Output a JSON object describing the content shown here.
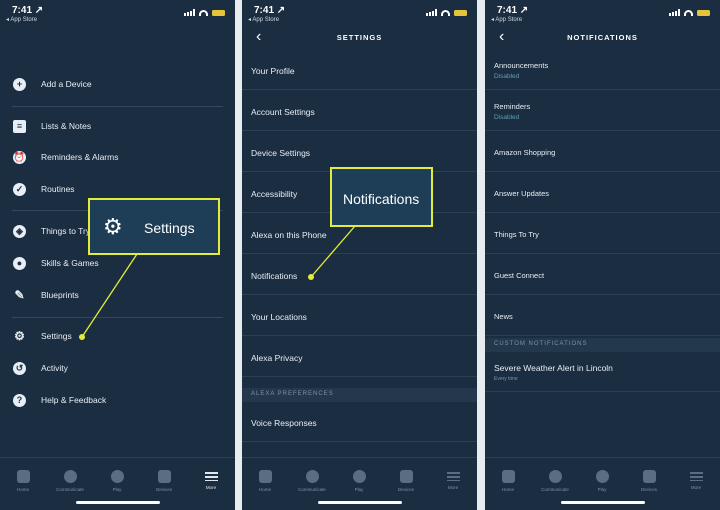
{
  "status": {
    "time": "7:41 ↗",
    "back_app": "◂ App Store"
  },
  "panel1": {
    "menu": [
      "Add a Device",
      "Lists & Notes",
      "Reminders & Alarms",
      "Routines",
      "Things to Try",
      "Skills & Games",
      "Blueprints",
      "Settings",
      "Activity",
      "Help & Feedback"
    ],
    "tabs": [
      "Home",
      "Communicate",
      "Play",
      "Devices",
      "More"
    ],
    "callout": "Settings",
    "menu_icons": [
      "plus-icon",
      "list-icon",
      "alarm-icon",
      "routines-icon",
      "compass-icon",
      "skills-icon",
      "pen-icon",
      "gear-icon",
      "history-icon",
      "help-icon"
    ]
  },
  "panel2": {
    "title": "SETTINGS",
    "rows": [
      "Your Profile",
      "Account Settings",
      "Device Settings",
      "Accessibility",
      "Alexa on this Phone",
      "Notifications",
      "Your Locations",
      "Alexa Privacy"
    ],
    "section": "ALEXA PREFERENCES",
    "rows2": [
      "Voice Responses"
    ],
    "tabs": [
      "Home",
      "Communicate",
      "Play",
      "Devices",
      "More"
    ],
    "callout": "Notifications"
  },
  "panel3": {
    "title": "NOTIFICATIONS",
    "rows": [
      {
        "label": "Announcements",
        "sub": "Disabled"
      },
      {
        "label": "Reminders",
        "sub": "Disabled"
      },
      {
        "label": "Amazon Shopping",
        "sub": ""
      },
      {
        "label": "Answer Updates",
        "sub": ""
      },
      {
        "label": "Things To Try",
        "sub": ""
      },
      {
        "label": "Guest Connect",
        "sub": ""
      },
      {
        "label": "News",
        "sub": ""
      }
    ],
    "section": "CUSTOM NOTIFICATIONS",
    "custom": {
      "label": "Severe Weather Alert in Lincoln",
      "sub": "Every time"
    },
    "tabs": [
      "Home",
      "Communicate",
      "Play",
      "Devices",
      "More"
    ]
  },
  "colors": {
    "panel_bg": "#1b2d40",
    "callout_border": "#e3ec3c",
    "pointer_dot": "#e3ec3c"
  }
}
